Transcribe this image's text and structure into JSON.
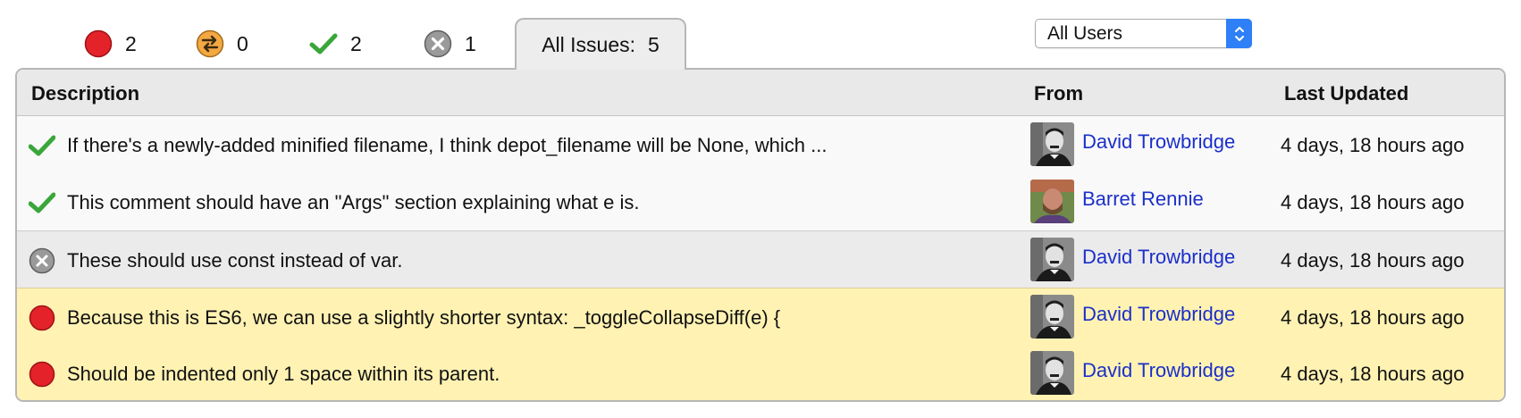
{
  "tabs": {
    "open": {
      "count": "2",
      "icon": "open-issue-icon",
      "color": "#e32329"
    },
    "verify": {
      "count": "0",
      "icon": "verify-arrows-icon",
      "color": "#f0a43a"
    },
    "resolved": {
      "count": "2",
      "icon": "checkmark-icon",
      "color": "#3aa63a"
    },
    "dropped": {
      "count": "1",
      "icon": "dropped-x-icon",
      "color": "#8b8b8b"
    },
    "all": {
      "label": "All Issues:",
      "count": "5"
    }
  },
  "user_filter": {
    "selected": "All Users"
  },
  "table": {
    "headers": {
      "description": "Description",
      "from": "From",
      "last_updated": "Last Updated"
    },
    "rows": [
      {
        "status": "resolved",
        "description": "If there's a newly-added minified filename, I think depot_filename will be None, which ...",
        "from": "David Trowbridge",
        "last_updated": "4 days, 18 hours ago"
      },
      {
        "status": "resolved",
        "description": "This comment should have an \"Args\" section explaining what e is.",
        "from": "Barret Rennie",
        "last_updated": "4 days, 18 hours ago"
      },
      {
        "status": "dropped",
        "description": "These should use const instead of var.",
        "from": "David Trowbridge",
        "last_updated": "4 days, 18 hours ago"
      },
      {
        "status": "open",
        "description": "Because this is ES6, we can use a slightly shorter syntax: _toggleCollapseDiff(e) {",
        "from": "David Trowbridge",
        "last_updated": "4 days, 18 hours ago"
      },
      {
        "status": "open",
        "description": "Should be indented only 1 space within its parent.",
        "from": "David Trowbridge",
        "last_updated": "4 days, 18 hours ago"
      }
    ]
  }
}
